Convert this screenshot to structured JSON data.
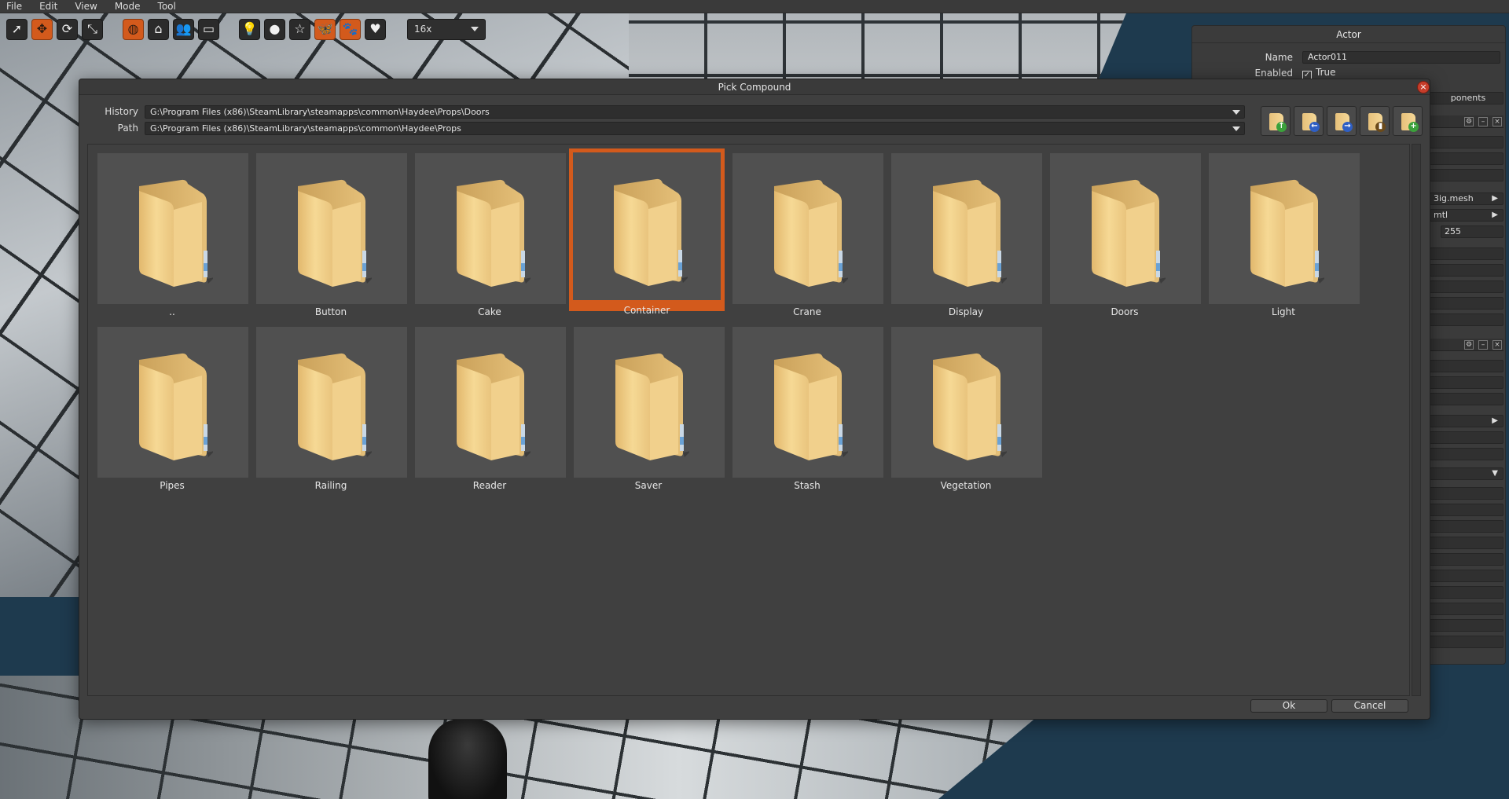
{
  "menubar": {
    "items": [
      "File",
      "Edit",
      "View",
      "Mode",
      "Tool"
    ]
  },
  "toolbar": {
    "tools": [
      {
        "icon": "select-arrow-icon",
        "glyph": "➚",
        "active": false
      },
      {
        "icon": "move-icon",
        "glyph": "✥",
        "active": true
      },
      {
        "icon": "rotate-icon",
        "glyph": "⟳",
        "active": false
      },
      {
        "icon": "scale-icon",
        "glyph": "⤡",
        "active": false
      }
    ],
    "modes": [
      {
        "icon": "globe-icon",
        "glyph": "◍",
        "active": true
      },
      {
        "icon": "home-icon",
        "glyph": "⌂",
        "active": false
      },
      {
        "icon": "people-icon",
        "glyph": "👥",
        "active": false
      },
      {
        "icon": "monitor-icon",
        "glyph": "▭",
        "active": false
      }
    ],
    "layers": [
      {
        "icon": "lightbulb-icon",
        "glyph": "💡",
        "active": false
      },
      {
        "icon": "sphere-icon",
        "glyph": "●",
        "active": false
      },
      {
        "icon": "star-icon",
        "glyph": "☆",
        "active": false
      },
      {
        "icon": "butterfly-icon",
        "glyph": "🦋",
        "active": true
      },
      {
        "icon": "paw-icon",
        "glyph": "🐾",
        "active": true
      },
      {
        "icon": "heart-icon",
        "glyph": "♥",
        "active": false
      }
    ],
    "zoom_value": "16x"
  },
  "inspector": {
    "title": "Actor",
    "name_label": "Name",
    "name_value": "Actor011",
    "enabled_label": "Enabled",
    "enabled_value": "True",
    "components_label": "ponents",
    "mesh_value": "3ig.mesh",
    "mtl_value": "mtl",
    "number_value": "255"
  },
  "dialog": {
    "title": "Pick Compound",
    "history_label": "History",
    "history_value": "G:\\Program Files (x86)\\SteamLibrary\\steamapps\\common\\Haydee\\Props\\Doors",
    "path_label": "Path",
    "path_value": "G:\\Program Files (x86)\\SteamLibrary\\steamapps\\common\\Haydee\\Props",
    "nav_buttons": [
      {
        "name": "folder-up-button",
        "badge_icon": "arrow-up-icon",
        "glyph": "↑",
        "color": "#3ba13b"
      },
      {
        "name": "folder-back-button",
        "badge_icon": "arrow-left-icon",
        "glyph": "←",
        "color": "#2f5fc4"
      },
      {
        "name": "folder-forward-button",
        "badge_icon": "arrow-right-icon",
        "glyph": "→",
        "color": "#2f5fc4"
      },
      {
        "name": "folder-root-button",
        "badge_icon": "door-icon",
        "glyph": "▮",
        "color": "#6b4a1a"
      },
      {
        "name": "folder-new-button",
        "badge_icon": "plus-icon",
        "glyph": "+",
        "color": "#3ba13b"
      }
    ],
    "folders": [
      "..",
      "Button",
      "Cake",
      "Container",
      "Crane",
      "Display",
      "Doors",
      "Light",
      "Pipes",
      "Railing",
      "Reader",
      "Saver",
      "Stash",
      "Vegetation"
    ],
    "selected_folder": "Container",
    "ok_label": "Ok",
    "cancel_label": "Cancel"
  },
  "colors": {
    "accent": "#d35a1c",
    "folder": "#f0cf86"
  }
}
